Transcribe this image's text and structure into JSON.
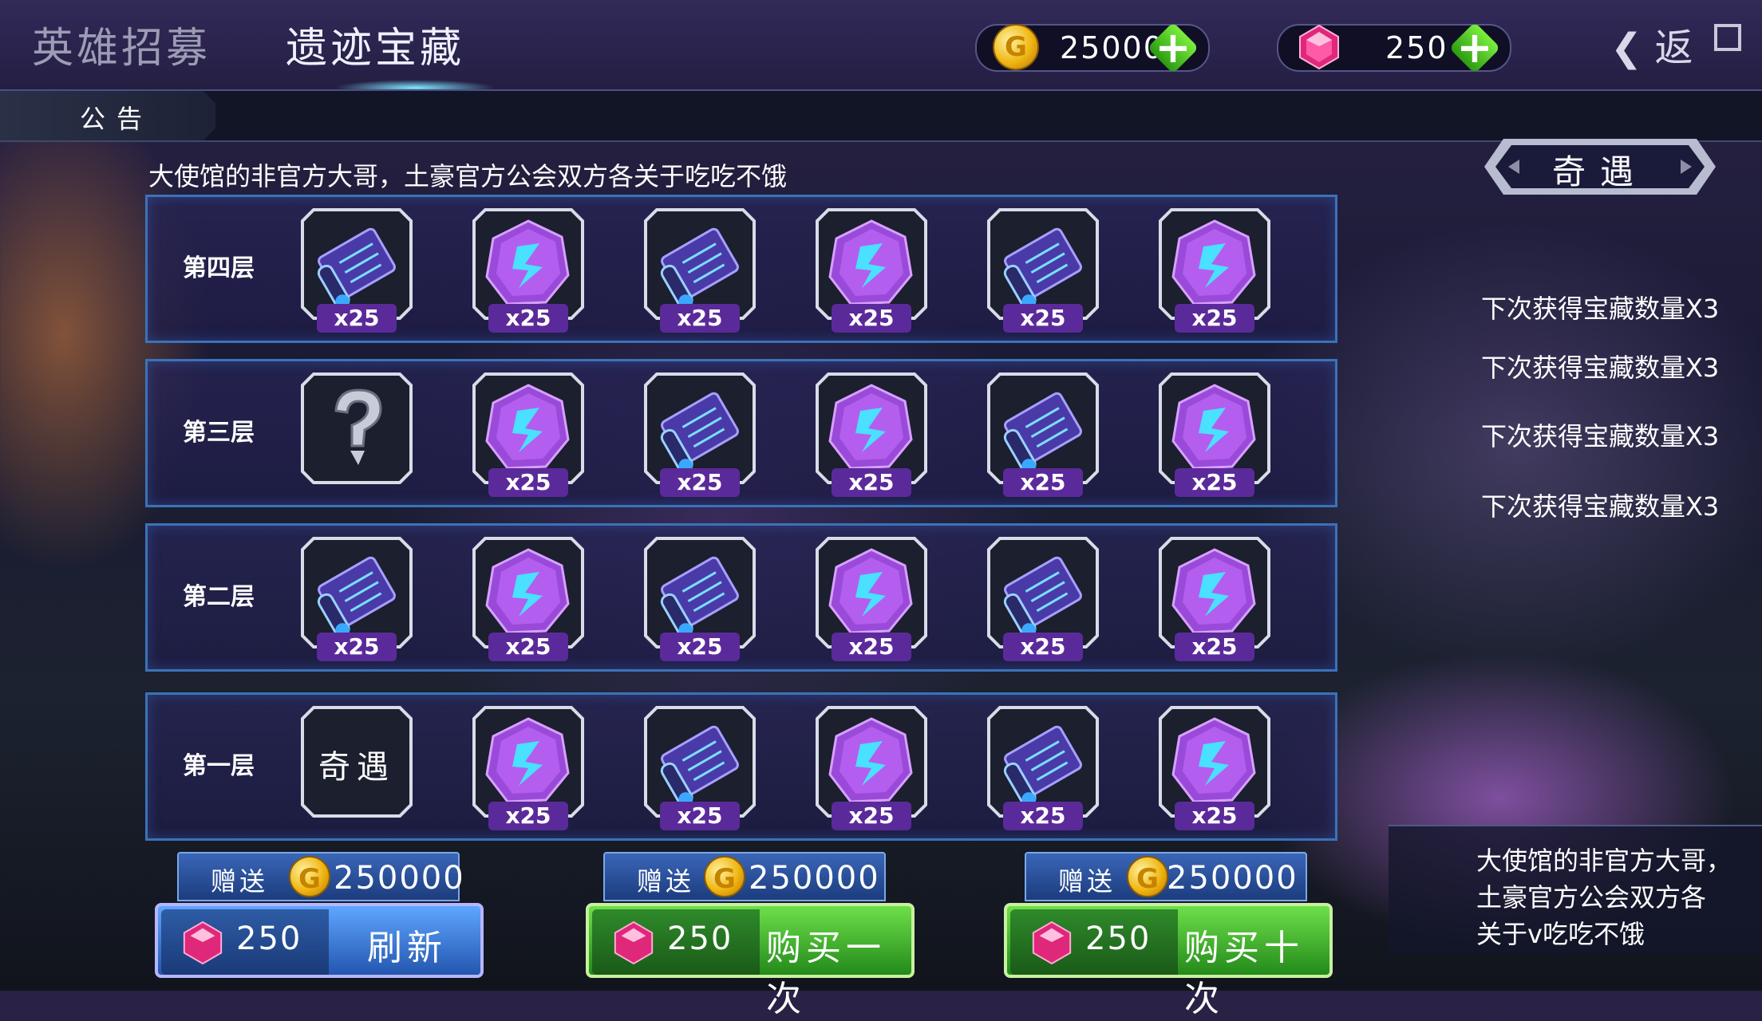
{
  "header": {
    "tabs": [
      {
        "label": "英雄招募",
        "active": false
      },
      {
        "label": "遗迹宝藏",
        "active": true
      }
    ],
    "gold": "250000",
    "gems": "250",
    "back_label": "返"
  },
  "notice": {
    "tab_label": "公告",
    "marquee": "大使馆的非官方大哥，土豪官方公会双方各关于吃吃不饿"
  },
  "floors": [
    {
      "label": "第四层",
      "tiles": [
        {
          "kind": "scroll",
          "count": "x25"
        },
        {
          "kind": "crystal",
          "count": "x25"
        },
        {
          "kind": "scroll",
          "count": "x25"
        },
        {
          "kind": "crystal",
          "count": "x25"
        },
        {
          "kind": "scroll",
          "count": "x25"
        },
        {
          "kind": "crystal",
          "count": "x25"
        }
      ]
    },
    {
      "label": "第三层",
      "tiles": [
        {
          "kind": "unknown",
          "count": ""
        },
        {
          "kind": "crystal",
          "count": "x25"
        },
        {
          "kind": "scroll",
          "count": "x25"
        },
        {
          "kind": "crystal",
          "count": "x25"
        },
        {
          "kind": "scroll",
          "count": "x25"
        },
        {
          "kind": "crystal",
          "count": "x25"
        }
      ]
    },
    {
      "label": "第二层",
      "tiles": [
        {
          "kind": "scroll",
          "count": "x25"
        },
        {
          "kind": "crystal",
          "count": "x25"
        },
        {
          "kind": "scroll",
          "count": "x25"
        },
        {
          "kind": "crystal",
          "count": "x25"
        },
        {
          "kind": "scroll",
          "count": "x25"
        },
        {
          "kind": "crystal",
          "count": "x25"
        }
      ]
    },
    {
      "label": "第一层",
      "tiles": [
        {
          "kind": "adventure",
          "text": "奇遇",
          "count": ""
        },
        {
          "kind": "crystal",
          "count": "x25"
        },
        {
          "kind": "scroll",
          "count": "x25"
        },
        {
          "kind": "crystal",
          "count": "x25"
        },
        {
          "kind": "scroll",
          "count": "x25"
        },
        {
          "kind": "crystal",
          "count": "x25"
        }
      ]
    }
  ],
  "side_panel": {
    "title": "奇遇",
    "bonuses": [
      "下次获得宝藏数量X3",
      "下次获得宝藏数量X3",
      "下次获得宝藏数量X3",
      "下次获得宝藏数量X3"
    ],
    "note": [
      "大使馆的非官方大哥，",
      "土豪官方公会双方各",
      "关于v吃吃不饿"
    ]
  },
  "actions": [
    {
      "gift_label": "赠送",
      "gift_amount": "250000",
      "price": "250",
      "label": "刷新",
      "color": "blue"
    },
    {
      "gift_label": "赠送",
      "gift_amount": "250000",
      "price": "250",
      "label": "购买一次",
      "color": "green"
    },
    {
      "gift_label": "赠送",
      "gift_amount": "250000",
      "price": "250",
      "label": "购买十次",
      "color": "green"
    }
  ],
  "colors": {
    "accent": "#7fe6ff",
    "gold": "#f0b614",
    "gem": "#e0287a",
    "purple_badge": "#5b2a9a"
  }
}
